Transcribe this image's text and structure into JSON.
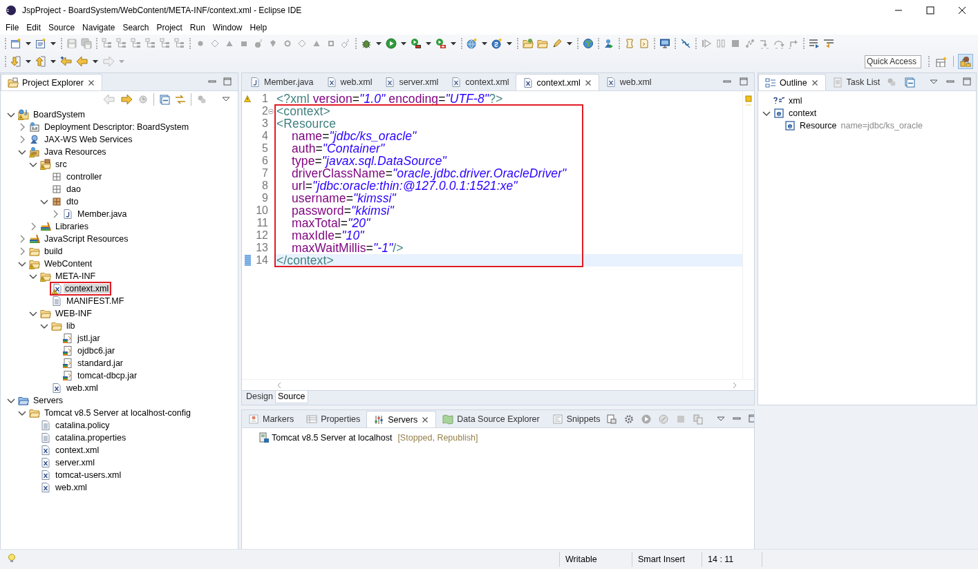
{
  "window": {
    "title": "JspProject - BoardSystem/WebContent/META-INF/context.xml - Eclipse IDE"
  },
  "menu": [
    "File",
    "Edit",
    "Source",
    "Navigate",
    "Search",
    "Project",
    "Run",
    "Window",
    "Help"
  ],
  "quick_access": {
    "placeholder": "Quick Access"
  },
  "project_explorer": {
    "tabs": [
      {
        "label": "Project Explorer",
        "kind": "explorer",
        "selected": true
      }
    ],
    "tree": [
      {
        "label": "BoardSystem",
        "kind": "project",
        "expanded": true,
        "warning": true,
        "selected": false,
        "children": [
          {
            "label": "Deployment Descriptor: BoardSystem",
            "kind": "descriptor",
            "expanded": false,
            "warning": false,
            "selected": false
          },
          {
            "label": "JAX-WS Web Services",
            "kind": "webservices",
            "expanded": false,
            "warning": false,
            "selected": false
          },
          {
            "label": "Java Resources",
            "kind": "javares",
            "expanded": true,
            "warning": true,
            "selected": false,
            "children": [
              {
                "label": "src",
                "kind": "srcfolder",
                "expanded": true,
                "warning": true,
                "selected": false,
                "children": [
                  {
                    "label": "controller",
                    "kind": "package",
                    "warning": false,
                    "selected": false
                  },
                  {
                    "label": "dao",
                    "kind": "package",
                    "warning": false,
                    "selected": false
                  },
                  {
                    "label": "dto",
                    "kind": "packagefull",
                    "expanded": true,
                    "warning": false,
                    "selected": false,
                    "children": [
                      {
                        "label": "Member.java",
                        "kind": "java",
                        "expanded": false,
                        "warning": false,
                        "selected": false
                      }
                    ]
                  }
                ]
              },
              {
                "label": "Libraries",
                "kind": "library",
                "expanded": false,
                "warning": false,
                "selected": false
              }
            ]
          },
          {
            "label": "JavaScript Resources",
            "kind": "library",
            "expanded": false,
            "warning": false,
            "selected": false
          },
          {
            "label": "build",
            "kind": "folder",
            "expanded": false,
            "warning": false,
            "selected": false
          },
          {
            "label": "WebContent",
            "kind": "folder",
            "expanded": true,
            "warning": true,
            "selected": false,
            "children": [
              {
                "label": "META-INF",
                "kind": "folder",
                "expanded": true,
                "warning": true,
                "selected": false,
                "children": [
                  {
                    "label": "context.xml",
                    "kind": "xml",
                    "warning": true,
                    "selected": true
                  },
                  {
                    "label": "MANIFEST.MF",
                    "kind": "text",
                    "warning": false,
                    "selected": false
                  }
                ]
              },
              {
                "label": "WEB-INF",
                "kind": "folder",
                "expanded": true,
                "warning": false,
                "selected": false,
                "children": [
                  {
                    "label": "lib",
                    "kind": "folder",
                    "expanded": true,
                    "warning": false,
                    "selected": false,
                    "children": [
                      {
                        "label": "jstl.jar",
                        "kind": "jar",
                        "warning": false,
                        "selected": false
                      },
                      {
                        "label": "ojdbc6.jar",
                        "kind": "jar",
                        "warning": false,
                        "selected": false
                      },
                      {
                        "label": "standard.jar",
                        "kind": "jar",
                        "warning": false,
                        "selected": false
                      },
                      {
                        "label": "tomcat-dbcp.jar",
                        "kind": "jar",
                        "warning": false,
                        "selected": false
                      }
                    ]
                  },
                  {
                    "label": "web.xml",
                    "kind": "xml",
                    "warning": false,
                    "selected": false
                  }
                ]
              }
            ]
          }
        ]
      },
      {
        "label": "Servers",
        "kind": "servers",
        "expanded": true,
        "warning": false,
        "selected": false,
        "children": [
          {
            "label": "Tomcat v8.5 Server at localhost-config",
            "kind": "folder",
            "expanded": true,
            "warning": false,
            "selected": false,
            "children": [
              {
                "label": "catalina.policy",
                "kind": "text",
                "warning": false,
                "selected": false
              },
              {
                "label": "catalina.properties",
                "kind": "text",
                "warning": false,
                "selected": false
              },
              {
                "label": "context.xml",
                "kind": "xml",
                "warning": false,
                "selected": false
              },
              {
                "label": "server.xml",
                "kind": "xml",
                "warning": false,
                "selected": false
              },
              {
                "label": "tomcat-users.xml",
                "kind": "xml",
                "warning": false,
                "selected": false
              },
              {
                "label": "web.xml",
                "kind": "xml",
                "warning": false,
                "selected": false
              }
            ]
          }
        ]
      }
    ]
  },
  "editor": {
    "tabs": [
      {
        "label": "Member.java",
        "kind": "java",
        "selected": false
      },
      {
        "label": "web.xml",
        "kind": "xml",
        "selected": false
      },
      {
        "label": "server.xml",
        "kind": "xml",
        "selected": false
      },
      {
        "label": "context.xml",
        "kind": "xml",
        "selected": false
      },
      {
        "label": "context.xml",
        "kind": "xml",
        "selected": true
      },
      {
        "label": "web.xml",
        "kind": "xml",
        "selected": false
      }
    ],
    "lines": [
      {
        "number": "1",
        "indented": false,
        "current": false,
        "warning": true,
        "foldable": false,
        "tokens": [
          {
            "kind": "tag",
            "text": "<?xml"
          },
          {
            "kind": "attr",
            "text": " version"
          },
          {
            "kind": "plain",
            "text": "="
          },
          {
            "kind": "value",
            "text": "\"1.0\""
          },
          {
            "kind": "attr",
            "text": " encoding"
          },
          {
            "kind": "plain",
            "text": "="
          },
          {
            "kind": "value",
            "text": "\"UTF-8\""
          },
          {
            "kind": "tag",
            "text": "?>"
          }
        ]
      },
      {
        "number": "2",
        "indented": false,
        "current": false,
        "warning": false,
        "foldable": true,
        "tokens": [
          {
            "kind": "tag",
            "text": "<context>"
          }
        ]
      },
      {
        "number": "3",
        "indented": false,
        "current": false,
        "warning": false,
        "foldable": false,
        "tokens": [
          {
            "kind": "tag",
            "text": "<Resource"
          }
        ]
      },
      {
        "number": "4",
        "indented": true,
        "current": false,
        "warning": false,
        "foldable": false,
        "tokens": [
          {
            "kind": "attr",
            "text": "name"
          },
          {
            "kind": "plain",
            "text": "="
          },
          {
            "kind": "value",
            "text": "\"jdbc/ks_oracle\""
          }
        ]
      },
      {
        "number": "5",
        "indented": true,
        "current": false,
        "warning": false,
        "foldable": false,
        "tokens": [
          {
            "kind": "attr",
            "text": "auth"
          },
          {
            "kind": "plain",
            "text": "="
          },
          {
            "kind": "value",
            "text": "\"Container\""
          }
        ]
      },
      {
        "number": "6",
        "indented": true,
        "current": false,
        "warning": false,
        "foldable": false,
        "tokens": [
          {
            "kind": "attr",
            "text": "type"
          },
          {
            "kind": "plain",
            "text": "="
          },
          {
            "kind": "value",
            "text": "\"javax.sql.DataSource\""
          }
        ]
      },
      {
        "number": "7",
        "indented": true,
        "current": false,
        "warning": false,
        "foldable": false,
        "tokens": [
          {
            "kind": "attr",
            "text": "driverClassName"
          },
          {
            "kind": "plain",
            "text": "="
          },
          {
            "kind": "value",
            "text": "\"oracle.jdbc.driver.OracleDriver\""
          }
        ]
      },
      {
        "number": "8",
        "indented": true,
        "current": false,
        "warning": false,
        "foldable": false,
        "tokens": [
          {
            "kind": "attr",
            "text": "url"
          },
          {
            "kind": "plain",
            "text": "="
          },
          {
            "kind": "value",
            "text": "\"jdbc:oracle:thin:@127.0.0.1:1521:xe\""
          }
        ]
      },
      {
        "number": "9",
        "indented": true,
        "current": false,
        "warning": false,
        "foldable": false,
        "tokens": [
          {
            "kind": "attr",
            "text": "username"
          },
          {
            "kind": "plain",
            "text": "="
          },
          {
            "kind": "value",
            "text": "\"kimssi\""
          }
        ]
      },
      {
        "number": "10",
        "indented": true,
        "current": false,
        "warning": false,
        "foldable": false,
        "tokens": [
          {
            "kind": "attr",
            "text": "password"
          },
          {
            "kind": "plain",
            "text": "="
          },
          {
            "kind": "value",
            "text": "\"kkimsi\""
          }
        ]
      },
      {
        "number": "11",
        "indented": true,
        "current": false,
        "warning": false,
        "foldable": false,
        "tokens": [
          {
            "kind": "attr",
            "text": "maxTotal"
          },
          {
            "kind": "plain",
            "text": "="
          },
          {
            "kind": "value",
            "text": "\"20\""
          }
        ]
      },
      {
        "number": "12",
        "indented": true,
        "current": false,
        "warning": false,
        "foldable": false,
        "tokens": [
          {
            "kind": "attr",
            "text": "maxIdle"
          },
          {
            "kind": "plain",
            "text": "="
          },
          {
            "kind": "value",
            "text": "\"10\""
          }
        ]
      },
      {
        "number": "13",
        "indented": true,
        "current": false,
        "warning": false,
        "foldable": false,
        "tokens": [
          {
            "kind": "attr",
            "text": "maxWaitMillis"
          },
          {
            "kind": "plain",
            "text": "="
          },
          {
            "kind": "value",
            "text": "\"-1\""
          },
          {
            "kind": "tag",
            "text": "/>"
          }
        ]
      },
      {
        "number": "14",
        "indented": false,
        "current": true,
        "warning": false,
        "foldable": false,
        "tokens": [
          {
            "kind": "tag",
            "text": "</context>"
          }
        ]
      }
    ],
    "bottom_tabs": [
      {
        "label": "Design",
        "selected": false
      },
      {
        "label": "Source",
        "selected": true
      }
    ]
  },
  "outline": {
    "tabs": [
      {
        "label": "Outline",
        "kind": "outline",
        "selected": true
      },
      {
        "label": "Task List",
        "kind": "tasks",
        "selected": false
      }
    ],
    "tree": [
      {
        "label": "xml",
        "kind": "pi",
        "warning": false,
        "selected": false
      },
      {
        "label": "context",
        "kind": "element",
        "expanded": true,
        "warning": false,
        "selected": false,
        "children": [
          {
            "label": "Resource",
            "detail": "name=jdbc/ks_oracle",
            "kind": "element",
            "warning": false,
            "selected": false
          }
        ]
      }
    ]
  },
  "bottom_panel": {
    "tabs": [
      {
        "label": "Markers",
        "kind": "markers",
        "selected": false
      },
      {
        "label": "Properties",
        "kind": "properties",
        "selected": false
      },
      {
        "label": "Servers",
        "kind": "servers",
        "selected": true
      },
      {
        "label": "Data Source Explorer",
        "kind": "datasource",
        "selected": false
      },
      {
        "label": "Snippets",
        "kind": "snippets",
        "selected": false
      }
    ],
    "servers": [
      {
        "name": "Tomcat v8.5 Server at localhost",
        "status": "[Stopped, Republish]"
      }
    ]
  },
  "status_bar": [
    "Writable",
    "Smart Insert",
    "14 : 11"
  ]
}
